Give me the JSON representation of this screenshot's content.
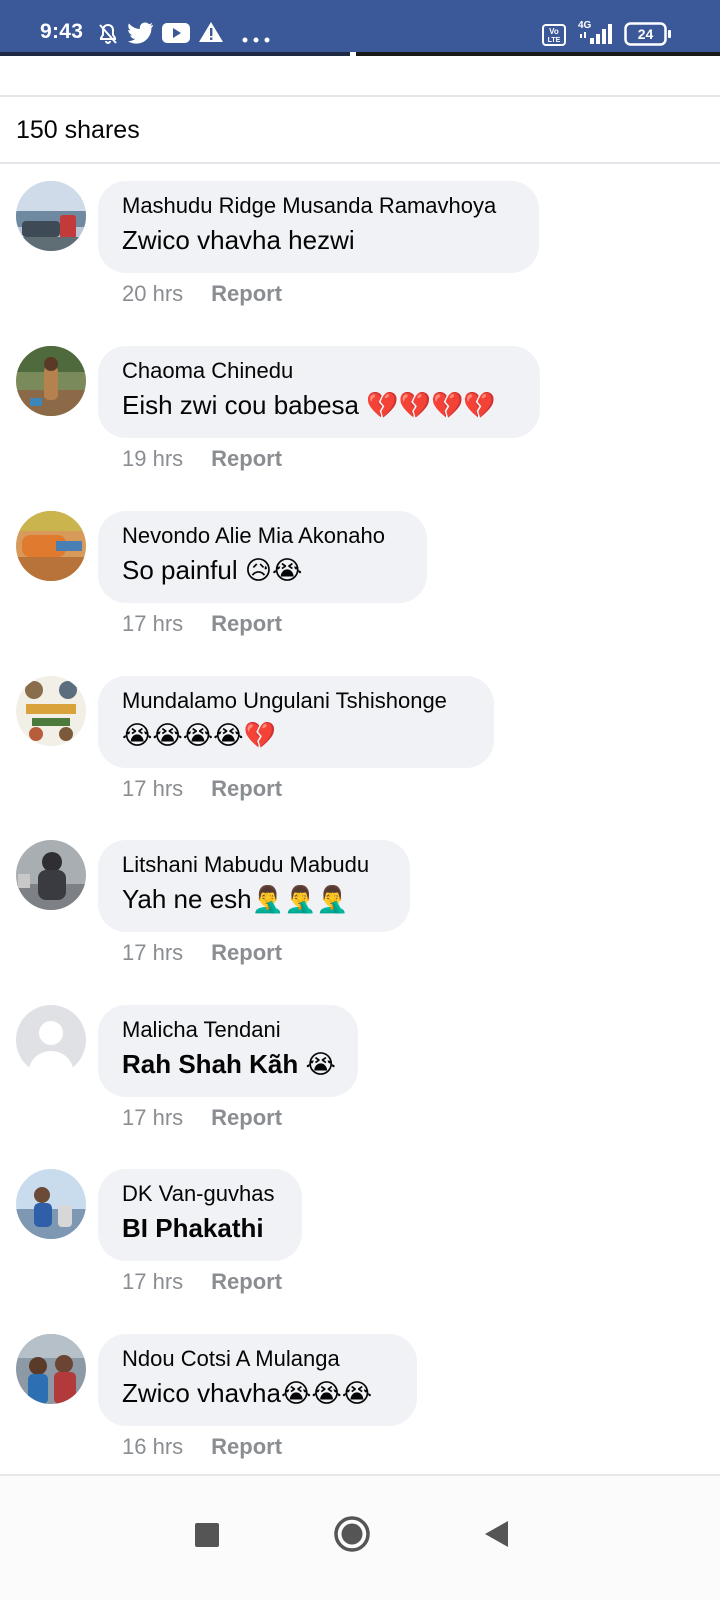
{
  "status_bar": {
    "time": "9:43",
    "left_icons": [
      "muted-bell-icon",
      "twitter-icon",
      "youtube-icon",
      "warning-icon",
      "more-dots-icon"
    ],
    "right_icons": [
      "volte-icon",
      "4g-signal-icon",
      "battery-icon"
    ],
    "network": "4G",
    "volte": "Vo LTE",
    "battery": "24"
  },
  "post": {
    "shares_text": "150 shares"
  },
  "comments": [
    {
      "name": "Mashudu Ridge Musanda Ramavhoya",
      "text": "Zwico vhavha hezwi",
      "bold": false,
      "time": "20 hrs",
      "action": "Report"
    },
    {
      "name": "Chaoma Chinedu",
      "text": "Eish zwi cou babesa 💔💔💔💔",
      "bold": false,
      "time": "19 hrs",
      "action": "Report"
    },
    {
      "name": "Nevondo Alie Mia Akonaho",
      "text": "So painful 😥😭",
      "bold": false,
      "time": "17 hrs",
      "action": "Report"
    },
    {
      "name": "Mundalamo Ungulani Tshishonge",
      "text": "😭😭😭😭💔",
      "bold": false,
      "time": "17 hrs",
      "action": "Report"
    },
    {
      "name": "Litshani Mabudu Mabudu",
      "text": "Yah ne esh🤦‍♂️🤦‍♂️🤦‍♂️",
      "bold": false,
      "time": "17 hrs",
      "action": "Report"
    },
    {
      "name": "Malicha Tendani",
      "text": "Rah Shah Kãh 😭",
      "bold": true,
      "time": "17 hrs",
      "action": "Report"
    },
    {
      "name": "DK Van-guvhas",
      "text": "BI Phakathi",
      "bold": true,
      "time": "17 hrs",
      "action": "Report"
    },
    {
      "name": "Ndou Cotsi A Mulanga",
      "text": "Zwico vhavha😭😭😭",
      "bold": false,
      "time": "16 hrs",
      "action": "Report"
    }
  ],
  "colors": {
    "status_bar": "#3b5998",
    "bubble": "#f0f2f5",
    "meta_text": "#8a8d91"
  },
  "nav": {
    "buttons": [
      "recents-square-icon",
      "home-circle-icon",
      "back-triangle-icon"
    ]
  }
}
